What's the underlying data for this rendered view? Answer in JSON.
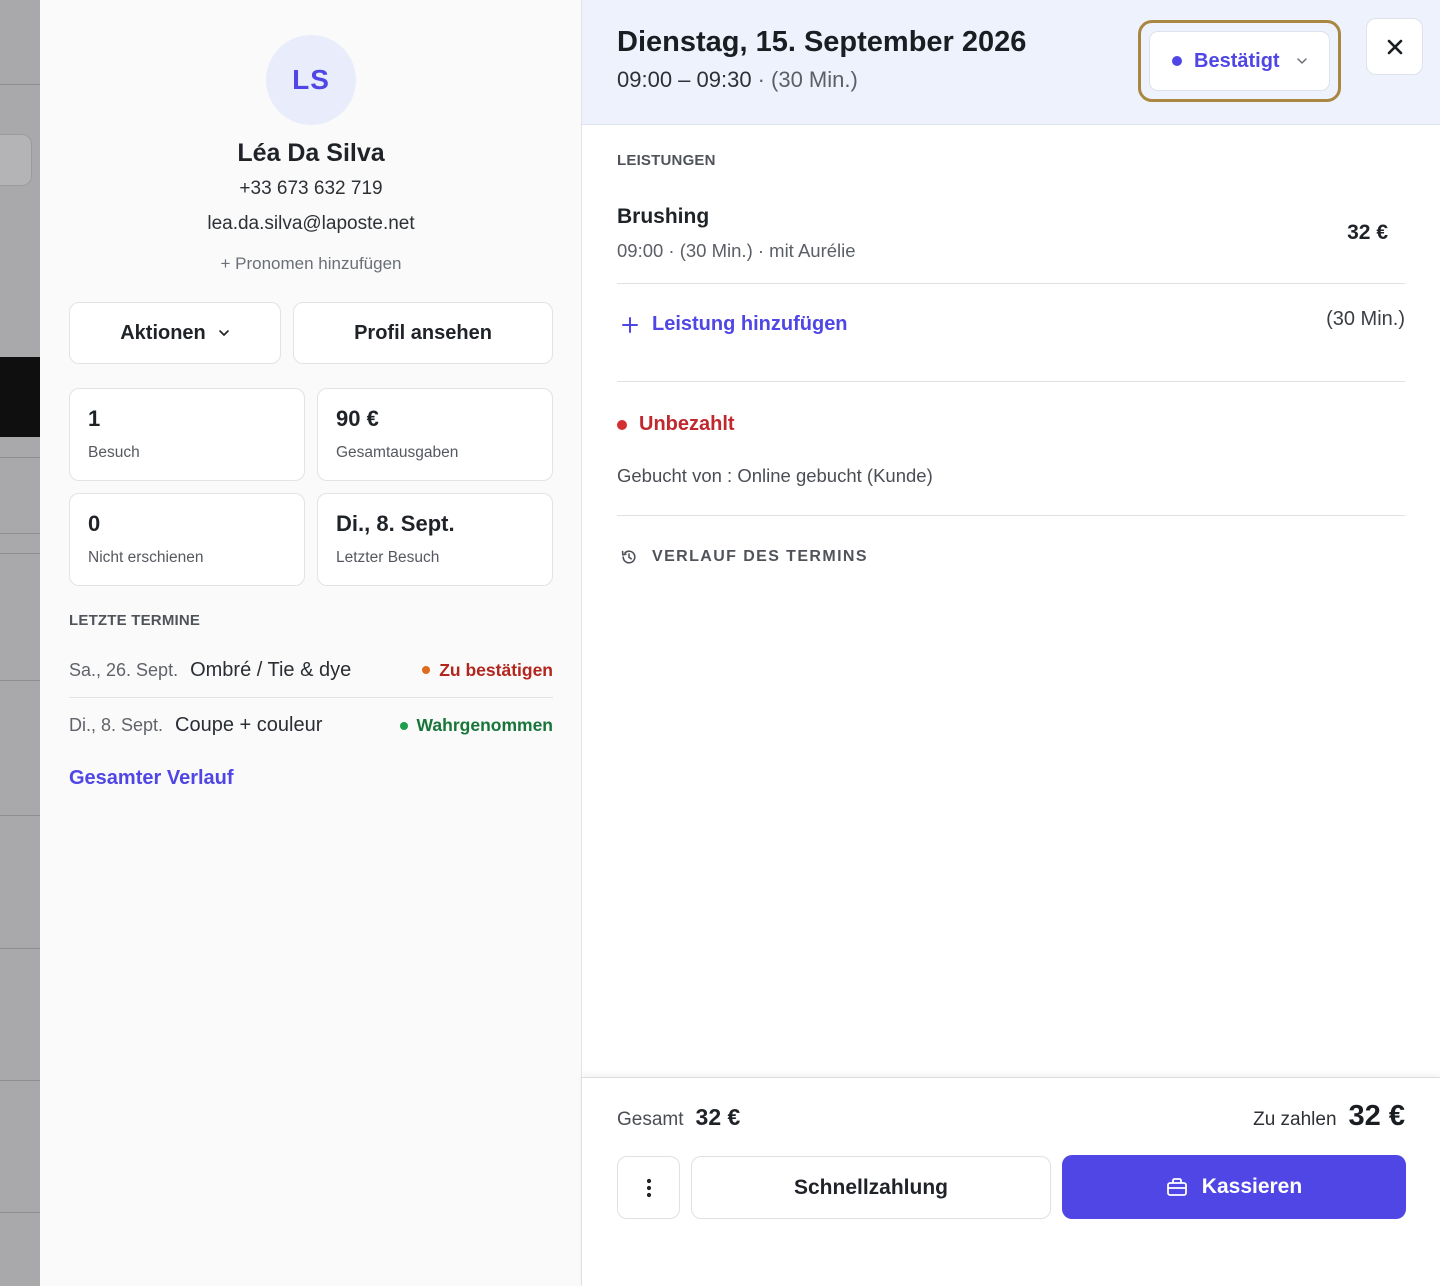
{
  "colors": {
    "accent": "#4f46e5",
    "confirmed": "#4f46e5",
    "unpaid": "#d32f2f",
    "to_confirm": "#e06a1e",
    "to_confirm_text": "#b3261e",
    "attended": "#1e9e4a",
    "attended_text": "#17753a",
    "highlight_border": "#a98743"
  },
  "client": {
    "initials": "LS",
    "name": "Léa Da Silva",
    "phone": "+33 673 632 719",
    "email": "lea.da.silva@laposte.net",
    "add_pronoun": "+ Pronomen hinzufügen",
    "actions_label": "Aktionen",
    "actions_icon": "chevron-down-icon",
    "profile_label": "Profil ansehen",
    "stats": [
      {
        "value": "1",
        "label": "Besuch"
      },
      {
        "value": "90 €",
        "label": "Gesamtausgaben"
      },
      {
        "value": "0",
        "label": "Nicht erschienen"
      },
      {
        "value": "Di., 8. Sept.",
        "label": "Letzter Besuch"
      }
    ],
    "recent_title": "LETZTE TERMINE",
    "recent": [
      {
        "date": "Sa., 26. Sept.",
        "service": "Ombré / Tie & dye",
        "status": "Zu bestätigen"
      },
      {
        "date": "Di., 8. Sept.",
        "service": "Coupe + couleur",
        "status": "Wahrgenommen"
      }
    ],
    "full_history": "Gesamter Verlauf"
  },
  "appointment": {
    "title": "Dienstag, 15. September 2026",
    "time_range": "09:00 – 09:30",
    "duration": "· (30 Min.)",
    "status": "Bestätigt",
    "status_icon": "chevron-down-icon",
    "close_icon": "close-icon",
    "services_title": "LEISTUNGEN",
    "service": {
      "name": "Brushing",
      "meta": "09:00 · (30 Min.) · mit Aurélie",
      "price": "32 €"
    },
    "add_service": "Leistung hinzufügen",
    "add_service_icon": "plus-icon",
    "add_duration": "(30 Min.)",
    "payment_status": "Unbezahlt",
    "booked_by": "Gebucht von : Online gebucht (Kunde)",
    "history_label": "VERLAUF DES TERMINS",
    "history_icon": "history-icon"
  },
  "footer": {
    "total_label": "Gesamt",
    "total_value": "32 €",
    "due_label": "Zu zahlen",
    "due_value": "32 €",
    "more_icon": "more-vertical-icon",
    "quick_pay": "Schnellzahlung",
    "checkout": "Kassieren",
    "checkout_icon": "register-icon"
  }
}
